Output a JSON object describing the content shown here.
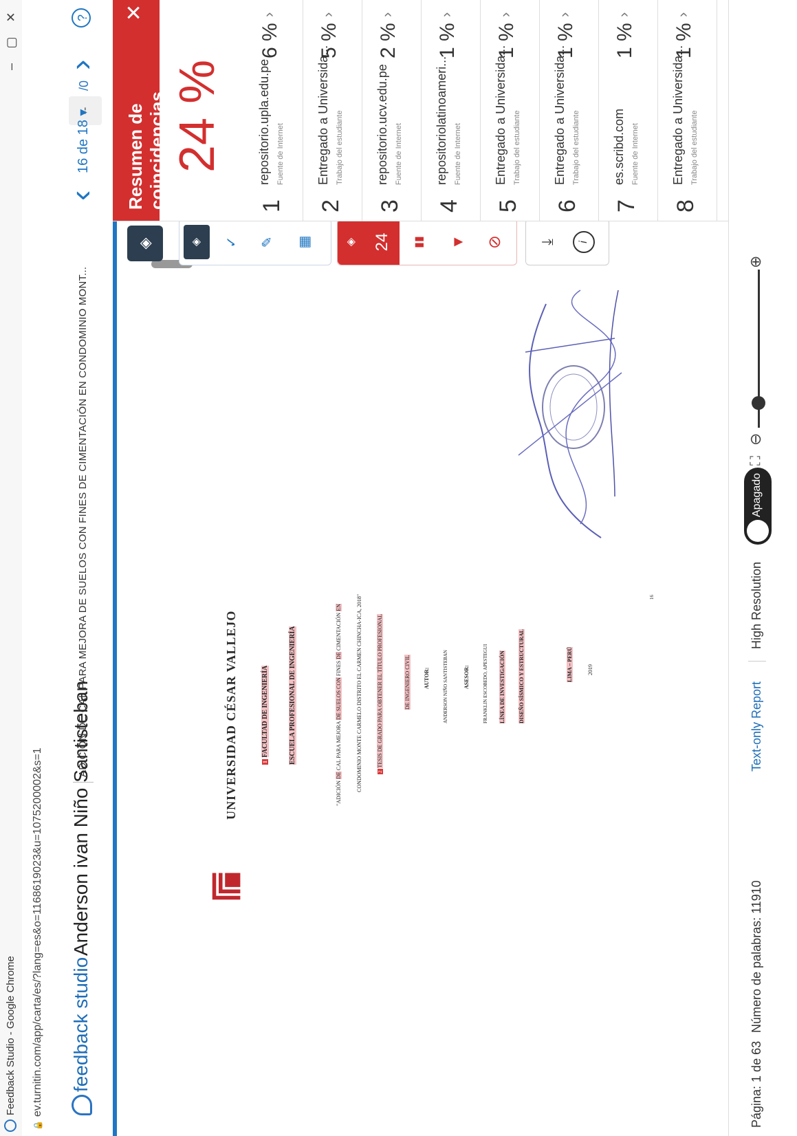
{
  "browser": {
    "window_title": "Feedback Studio - Google Chrome",
    "url": "ev.turnitin.com/app/carta/es/?lang=es&o=1168619023&u=1075200002&s=1",
    "minimize": "–",
    "maximize": "▢",
    "close": "✕"
  },
  "header": {
    "brand": "feedback studio",
    "student": "Anderson ivan Niño Santisteban",
    "doc_title": "ADICIÓN DE CAL PARA MEJORA DE SUELOS CON FINES DE CIMENTACIÓN EN CONDOMINIO MONT...",
    "page_input": "--",
    "page_total": "/0",
    "match_counter": "16 de 18 ▾",
    "help": "?"
  },
  "document": {
    "university": "UNIVERSIDAD CÉSAR VALLEJO",
    "faculty": "FACULTAD DE INGENIERÍA",
    "school": "ESCUELA PROFESIONAL DE INGENIERÍA",
    "title_line1_a": "\"ADICIÓN ",
    "title_line1_b": "DE",
    "title_line1_c": " CAL PARA MEJORA ",
    "title_line1_d": "DE SUELOS CON",
    "title_line1_e": " FINES ",
    "title_line1_f": "DE",
    "title_line1_g": " CIMENTACIÓN ",
    "title_line1_h": "EN",
    "title_line2": "CONDOMINIO MONTE CARMELO DISTRITO EL CARMEN CHINCHA-ICA, 2018\"",
    "thesis_line": "TESIS DE GRADO PARA OBTENER EL TÍTULO PROFESIONAL",
    "degree": "DE INGENIERO CIVIL",
    "author_label": "AUTOR:",
    "author": "ANDERSON NIÑO SANTISTEBAN",
    "advisor_label": "ASESOR:",
    "advisor": "FRANKLIN ESCOBEDO, APESTEGUI",
    "research_label": "LÍNEA DE INVESTIGACIÓN",
    "research": "DISEÑO SÍSMICO Y ESTRUCTURAL",
    "place": "LIMA – PERÚ",
    "year": "2019",
    "page_num": "16",
    "marker_1": "1",
    "marker_2": "2"
  },
  "toolbar": {
    "layers": "◈",
    "layer_small": "◈",
    "grading": "✓",
    "edit": "✎",
    "grid": "▦",
    "sim_score": "24",
    "sim_icon": "◈",
    "chart": "▮▮",
    "filter": "▼",
    "exclude": "⊘",
    "download": "⤓",
    "info": "i"
  },
  "panel": {
    "title": "Resumen de coincidencias",
    "close": "✕",
    "total_percent": "24 %",
    "scroll_up": "︿",
    "scroll_down": "﹀",
    "matches": [
      {
        "num": "1",
        "source": "repositorio.upla.edu.pe",
        "type": "Fuente de Internet",
        "percent": "6 %"
      },
      {
        "num": "2",
        "source": "Entregado a Universida...",
        "type": "Trabajo del estudiante",
        "percent": "5 %"
      },
      {
        "num": "3",
        "source": "repositorio.ucv.edu.pe",
        "type": "Fuente de Internet",
        "percent": "2 %"
      },
      {
        "num": "4",
        "source": "repositoriolatinoameri...",
        "type": "Fuente de Internet",
        "percent": "1 %"
      },
      {
        "num": "5",
        "source": "Entregado a Universida...",
        "type": "Trabajo del estudiante",
        "percent": "1 %"
      },
      {
        "num": "6",
        "source": "Entregado a Universida...",
        "type": "Trabajo del estudiante",
        "percent": "1 %"
      },
      {
        "num": "7",
        "source": "es.scribd.com",
        "type": "Fuente de Internet",
        "percent": "1 %"
      },
      {
        "num": "8",
        "source": "Entregado a Universida...",
        "type": "Trabajo del estudiante",
        "percent": "1 %"
      }
    ],
    "chevron": "›"
  },
  "statusbar": {
    "page": "Página: 1 de 63",
    "words": "Número de palabras: 11910",
    "text_only": "Text-only Report",
    "high_res": "High Resolution",
    "toggle_state": "Apagado",
    "fullscreen": "⛶",
    "zoom_out": "⊖",
    "zoom_in": "⊕"
  },
  "colors": {
    "accent_blue": "#1f76c2",
    "match_red": "#d32f2f",
    "highlight": "#f3c1c4"
  }
}
